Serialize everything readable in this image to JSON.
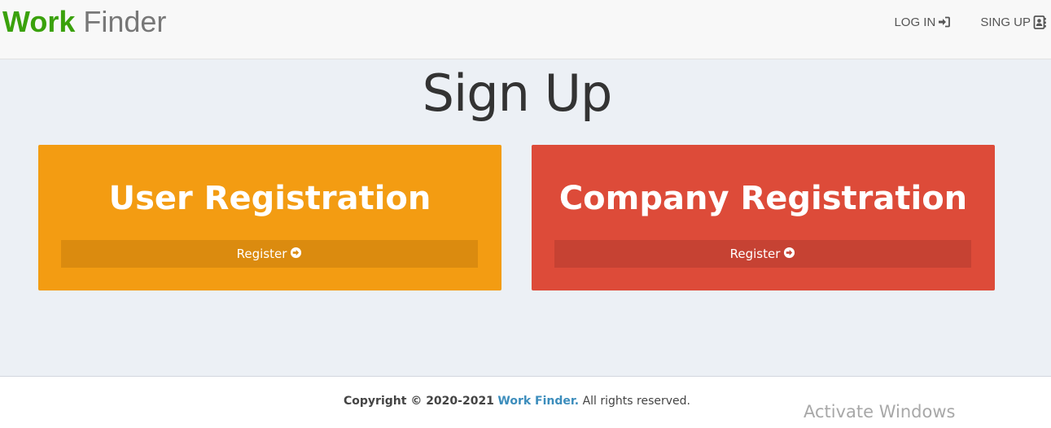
{
  "navbar": {
    "brand_accent": "Work",
    "brand_rest": "Finder",
    "links": [
      {
        "label": "LOG IN",
        "icon": "sign-in-icon"
      },
      {
        "label": "SING UP",
        "icon": "address-book-icon"
      }
    ]
  },
  "main": {
    "title": "Sign Up",
    "boxes": [
      {
        "title": "User Registration",
        "button_label": "Register",
        "icon": "arrow-circle-right-icon",
        "color": "#f39c12"
      },
      {
        "title": "Company Registration",
        "button_label": "Register",
        "icon": "arrow-circle-right-icon",
        "color": "#dd4b39"
      }
    ]
  },
  "footer": {
    "copyright_prefix": "Copyright © 2020-2021",
    "brand_link": "Work Finder.",
    "suffix": "All rights reserved."
  },
  "watermark": "Activate Windows",
  "colors": {
    "brand_green": "#3aa10b",
    "link_blue": "#3cbdbc",
    "content_bg": "#ecf0f5"
  }
}
